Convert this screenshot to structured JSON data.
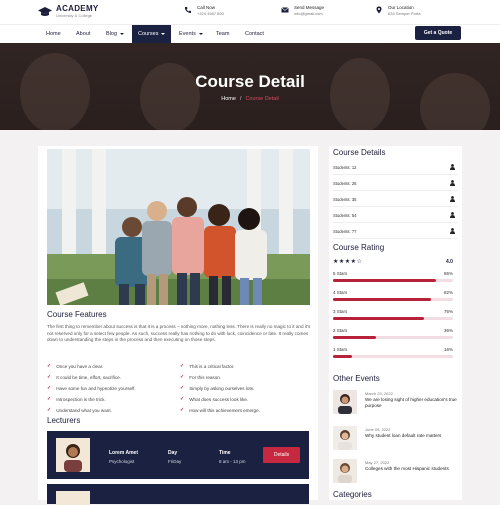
{
  "brand": {
    "title": "ACADEMY",
    "subtitle": "University & College"
  },
  "topinfo": [
    {
      "title": "Call Now",
      "value": "+324 4567 890"
    },
    {
      "title": "Send Message",
      "value": "info@gmail.com"
    },
    {
      "title": "Our Location",
      "value": "634 Semper Porta"
    }
  ],
  "nav": {
    "items": [
      "Home",
      "About",
      "Blog",
      "Courses",
      "Events",
      "Team",
      "Contact"
    ],
    "quote": "Get a Quote"
  },
  "hero": {
    "title": "Course Detail",
    "crumb_home": "Home",
    "crumb_sep": "/",
    "crumb_current": "Course Detail"
  },
  "features": {
    "title": "Course Features",
    "text": "The first thing to remember about success is that it is a process – nothing more, nothing less. There is really no magic to it and it's not reserved only for a select few people. As such, success really has nothing to do with luck, coincidence or fate. It really comes down to understanding the steps in the process and then executing on those steps.",
    "left": [
      "Once you have a clear.",
      "It could be time, effort, sacrifice.",
      "Have some fun and hypnotize yourself.",
      "Introspection is the trick.",
      "Understand what you want."
    ],
    "right": [
      "This is a critical factor.",
      "For this reason.",
      "Simply by asking ourselves lots.",
      "What does success look like.",
      "How will this achievement emerge."
    ]
  },
  "lecturers": {
    "title": "Lecturers",
    "items": [
      {
        "name": "Lorem Amet",
        "role": "Psychologist",
        "day_label": "Day",
        "day": "FriDay",
        "time_label": "Time",
        "time": "8 am - 13 pm",
        "button": "Details"
      }
    ]
  },
  "sidebar": {
    "details_title": "Course Details",
    "students": [
      "Students: 12",
      "Students: 26",
      "Students: 35",
      "Students: 54",
      "Students: 77"
    ],
    "rating_title": "Course Rating",
    "rating_stars": "★★★★☆",
    "rating_value": "4.0",
    "ratings": [
      {
        "label": "5 Stars",
        "pct_text": "86%",
        "pct": 86
      },
      {
        "label": "4 Stars",
        "pct_text": "82%",
        "pct": 82
      },
      {
        "label": "3 Stars",
        "pct_text": "76%",
        "pct": 76
      },
      {
        "label": "2 Stars",
        "pct_text": "36%",
        "pct": 36
      },
      {
        "label": "1 Stars",
        "pct_text": "16%",
        "pct": 16
      }
    ],
    "events_title": "Other Events",
    "events": [
      {
        "date": "March 23, 2022",
        "title": "We are losing sight of higher education's true purpose"
      },
      {
        "date": "June 09, 2022",
        "title": "Why student loan default rate matters"
      },
      {
        "date": "May 27, 2022",
        "title": "Colleges with the most Hispanic students"
      }
    ],
    "categories_title": "Categories"
  },
  "colors": {
    "navy": "#1b2140",
    "accent": "#c6283f",
    "bar": "#b8213a"
  }
}
